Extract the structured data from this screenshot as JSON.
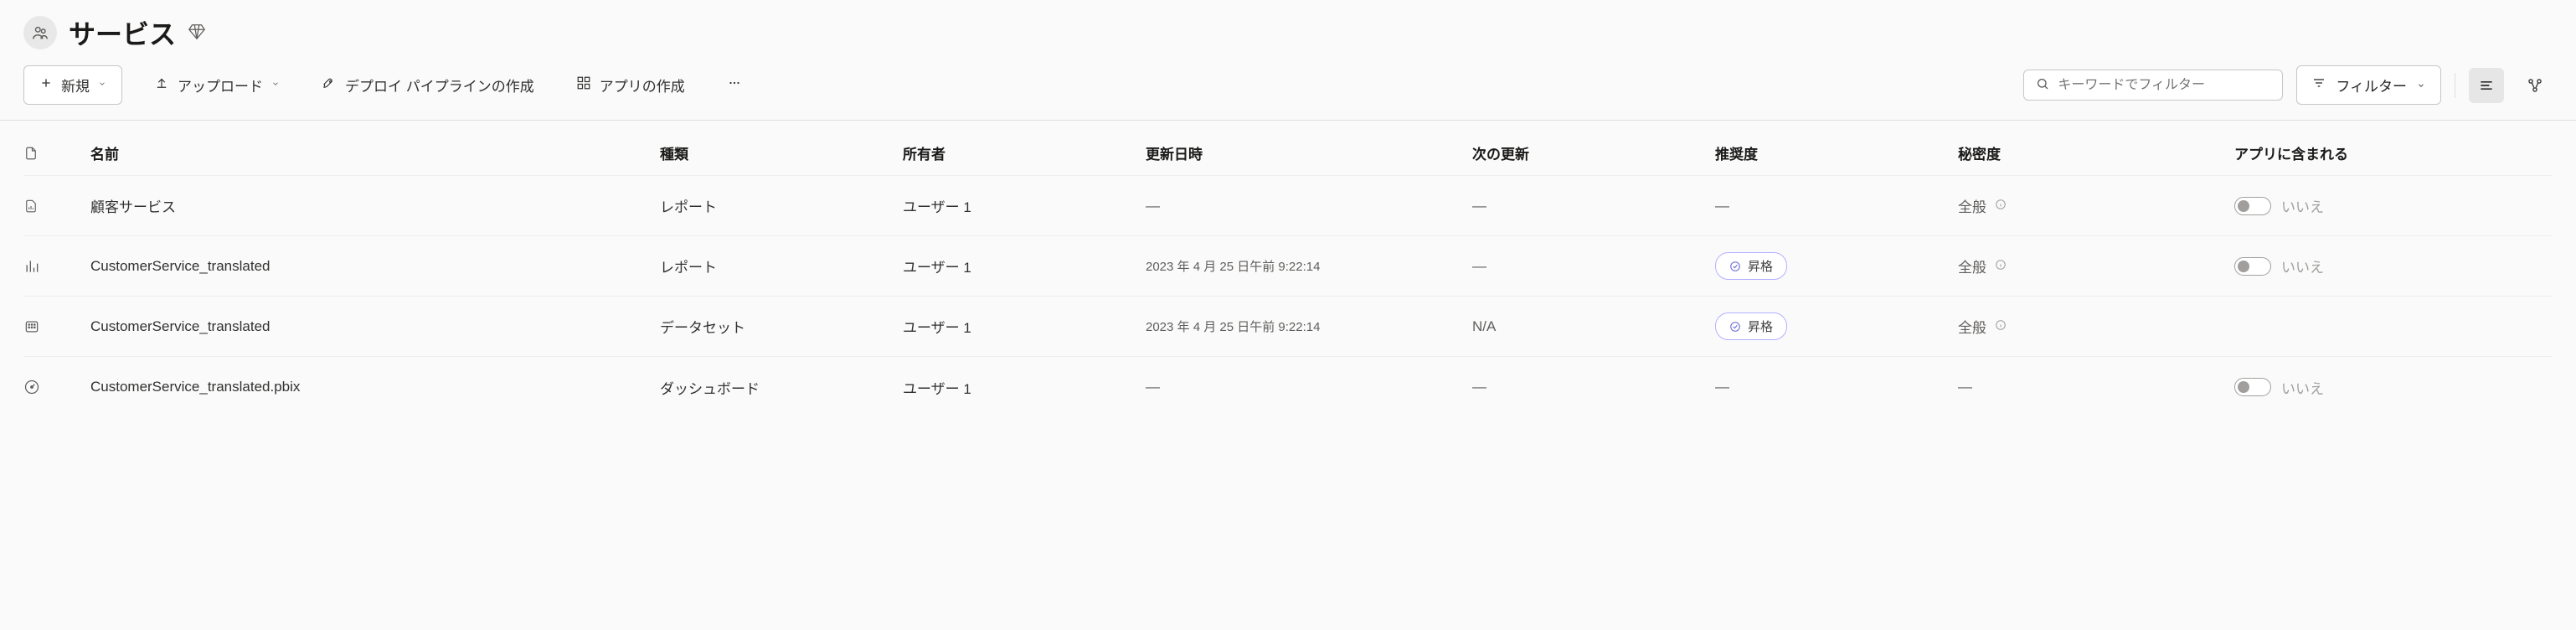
{
  "workspace": {
    "title": "サービス"
  },
  "toolbar": {
    "new_label": "新規",
    "upload_label": "アップロード",
    "deploy_label": "デプロイ パイプラインの作成",
    "create_app_label": "アプリの作成",
    "search_placeholder": "キーワードでフィルター",
    "filter_label": "フィルター"
  },
  "columns": {
    "name": "名前",
    "type": "種類",
    "owner": "所有者",
    "refreshed": "更新日時",
    "next_refresh": "次の更新",
    "endorsement": "推奨度",
    "sensitivity": "秘密度",
    "included": "アプリに含まれる"
  },
  "endorsement_values": {
    "promoted": "昇格"
  },
  "sensitivity_values": {
    "general": "全般"
  },
  "toggle_off_label": "いいえ",
  "rows": [
    {
      "icon": "report",
      "name": "顧客サービス",
      "type": "レポート",
      "owner": "ユーザー 1",
      "refreshed": "—",
      "next_refresh": "—",
      "endorsement": null,
      "sensitivity": "全般",
      "included": "いいえ"
    },
    {
      "icon": "report-bars",
      "name": "CustomerService_translated",
      "type": "レポート",
      "owner": "ユーザー 1",
      "refreshed": "2023 年 4 月 25 日午前 9:22:14",
      "next_refresh": "—",
      "endorsement": "昇格",
      "sensitivity": "全般",
      "included": "いいえ"
    },
    {
      "icon": "dataset",
      "name": "CustomerService_translated",
      "type": "データセット",
      "owner": "ユーザー 1",
      "refreshed": "2023 年 4 月 25 日午前 9:22:14",
      "next_refresh": "N/A",
      "endorsement": "昇格",
      "sensitivity": "全般",
      "included": null
    },
    {
      "icon": "dashboard",
      "name": "CustomerService_translated.pbix",
      "type": "ダッシュボード",
      "owner": "ユーザー 1",
      "refreshed": "—",
      "next_refresh": "—",
      "endorsement": null,
      "sensitivity": null,
      "included": "いいえ"
    }
  ]
}
